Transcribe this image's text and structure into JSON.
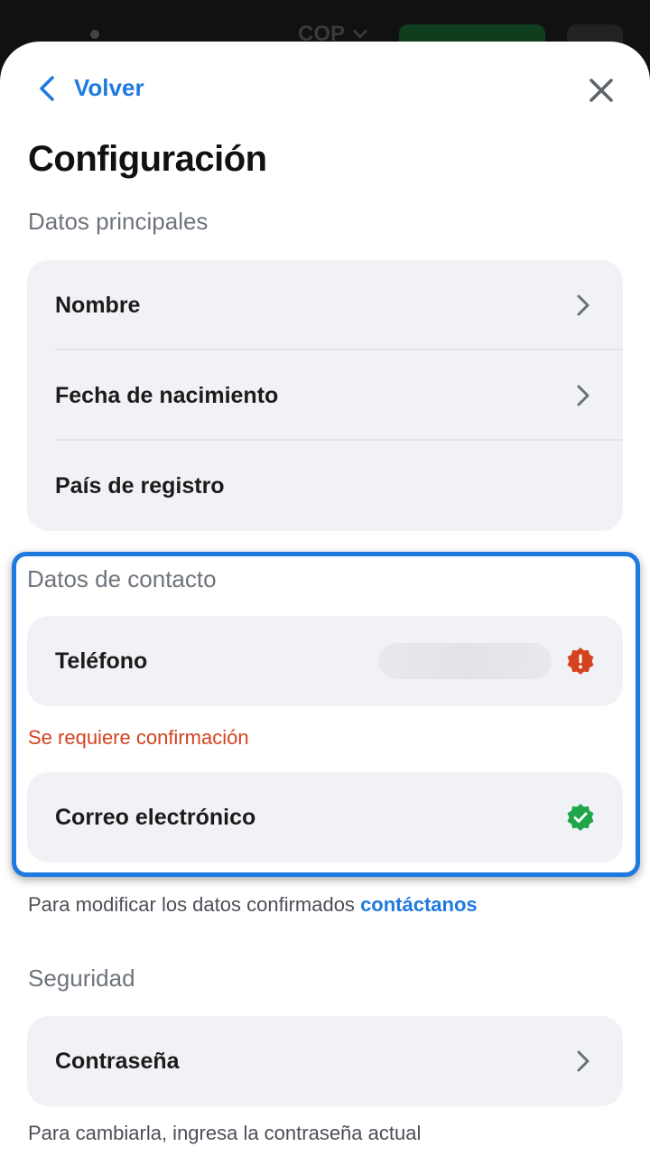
{
  "background": {
    "currency": "COP"
  },
  "header": {
    "back_label": "Volver"
  },
  "page_title": "Configuración",
  "sections": {
    "main": {
      "title": "Datos principales",
      "items": [
        {
          "label": "Nombre"
        },
        {
          "label": "Fecha de nacimiento"
        },
        {
          "label": "País de registro"
        }
      ]
    },
    "contact": {
      "title": "Datos de contacto",
      "phone_label": "Teléfono",
      "phone_error": "Se requiere confirmación",
      "email_label": "Correo electrónico",
      "hint_text": "Para modificar los datos confirmados ",
      "hint_link": "contáctanos"
    },
    "security": {
      "title": "Seguridad",
      "password_label": "Contraseña",
      "hint_text": "Para cambiarla, ingresa la contraseña actual"
    }
  },
  "colors": {
    "accent": "#1f7ae0",
    "error": "#d4431f",
    "success": "#1fa64a",
    "card_bg": "#f1f2f6"
  },
  "icons": {
    "back": "chevron-left-icon",
    "close": "close-icon",
    "chevron": "chevron-right-icon",
    "warning": "warning-badge-icon",
    "verified": "verified-badge-icon"
  }
}
